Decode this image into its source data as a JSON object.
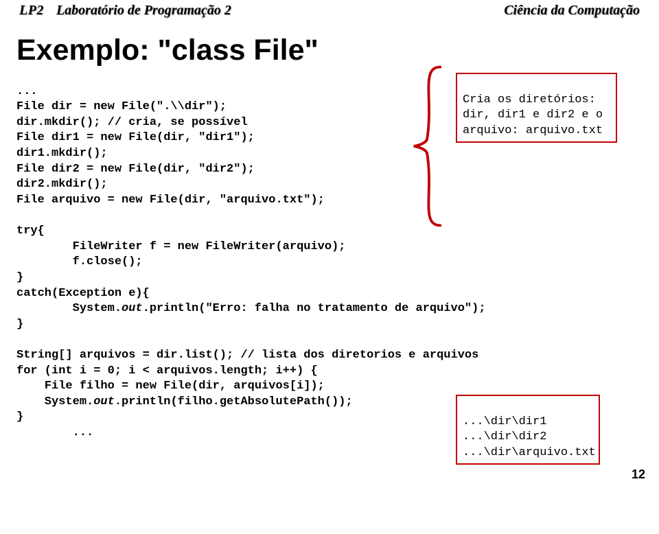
{
  "header": {
    "course_code": "LP2",
    "course_name": "Laboratório de Programação 2",
    "department": "Ciência da Computação"
  },
  "title": "Exemplo: \"class File\"",
  "code": {
    "l01": "...",
    "l02": "File dir = new File(\".\\\\dir\");",
    "l03": "dir.mkdir(); // cria, se possível",
    "l04": "File dir1 = new File(dir, \"dir1\");",
    "l05": "dir1.mkdir();",
    "l06": "File dir2 = new File(dir, \"dir2\");",
    "l07": "dir2.mkdir();",
    "l08": "File arquivo = new File(dir, \"arquivo.txt\");",
    "l09": "",
    "l10": "try{",
    "l11": "        FileWriter f = new FileWriter(arquivo);",
    "l12": "        f.close();",
    "l13": "}",
    "l14": "catch(Exception e){",
    "l15_a": "        System.",
    "l15_b": "out",
    "l15_c": ".println(\"Erro: falha no tratamento de arquivo\");",
    "l16": "}",
    "l17": "",
    "l18": "String[] arquivos = dir.list(); // lista dos diretorios e arquivos",
    "l19": "for (int i = 0; i < arquivos.length; i++) {",
    "l20": "    File filho = new File(dir, arquivos[i]);",
    "l21_a": "    System.",
    "l21_b": "out",
    "l21_c": ".println(filho.getAbsolutePath());",
    "l22": "}",
    "l23": "        ..."
  },
  "callout1": {
    "line1": "Cria os diretórios:",
    "line2": "dir, dir1 e dir2 e o",
    "line3": "arquivo: arquivo.txt"
  },
  "callout2": {
    "line1": "...\\dir\\dir1",
    "line2": "...\\dir\\dir2",
    "line3": "...\\dir\\arquivo.txt"
  },
  "page_number": "12"
}
